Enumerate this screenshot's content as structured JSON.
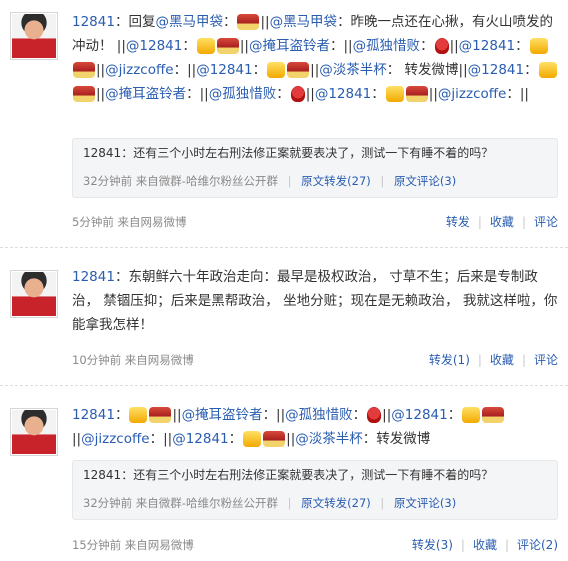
{
  "posts": [
    {
      "user": "12841",
      "text_parts": [
        "：回复",
        "@黑马甲袋",
        "：",
        "||",
        "@黑马甲袋",
        "：昨晚一点还在心揪，有火山喷发的冲动！ ||",
        "@12841",
        "：",
        "||",
        "@掩耳盗铃者",
        "：||",
        "@孤独惜败",
        "：",
        "||",
        "@12841",
        "：",
        "||",
        "@jizzcoffe",
        "：||",
        "@12841",
        "：",
        "||",
        "@淡茶半杯",
        "： 转发微博||",
        "@12841",
        "：",
        "||",
        "@掩耳盗铃者",
        "：||",
        "@孤独惜败",
        "：",
        "||",
        "@12841",
        "：",
        "||",
        "@jizzcoffe",
        "：||"
      ],
      "quote": {
        "user": "12841",
        "text": "：还有三个小时左右刑法修正案就要表决了，测试一下有睡不着的吗？",
        "time": "32分钟前",
        "source": "来自微群-哈维尔粉丝公开群",
        "repost": "原文转发(27)",
        "comment": "原文评论(3)"
      },
      "time": "5分钟前",
      "source": "来自网易微博",
      "actions": {
        "repost": "转发",
        "favorite": "收藏",
        "comment": "评论"
      }
    },
    {
      "user": "12841",
      "text": "：东朝鲜六十年政治走向：最早是极权政治， 寸草不生；后来是专制政治， 禁锢压抑；后来是黑帮政治， 坐地分赃；现在是无赖政治， 我就这样啦，你能拿我怎样！",
      "time": "10分钟前",
      "source": "来自网易微博",
      "actions": {
        "repost": "转发(1)",
        "favorite": "收藏",
        "comment": "评论"
      }
    },
    {
      "user": "12841",
      "text_parts": [
        "：",
        "||",
        "@掩耳盗铃者",
        "：||",
        "@孤独惜败",
        "：",
        "||",
        "@12841",
        "：",
        "||",
        "@jizzcoffe",
        "：||",
        "@12841",
        "：",
        "||",
        "@淡茶半杯",
        "：转发微博"
      ],
      "quote": {
        "user": "12841",
        "text": "：还有三个小时左右刑法修正案就要表决了，测试一下有睡不着的吗？",
        "time": "32分钟前",
        "source": "来自微群-哈维尔粉丝公开群",
        "repost": "原文转发(27)",
        "comment": "原文评论(3)"
      },
      "time": "15分钟前",
      "source": "来自网易微博",
      "actions": {
        "repost": "转发(3)",
        "favorite": "收藏",
        "comment": "评论(2)"
      }
    }
  ]
}
